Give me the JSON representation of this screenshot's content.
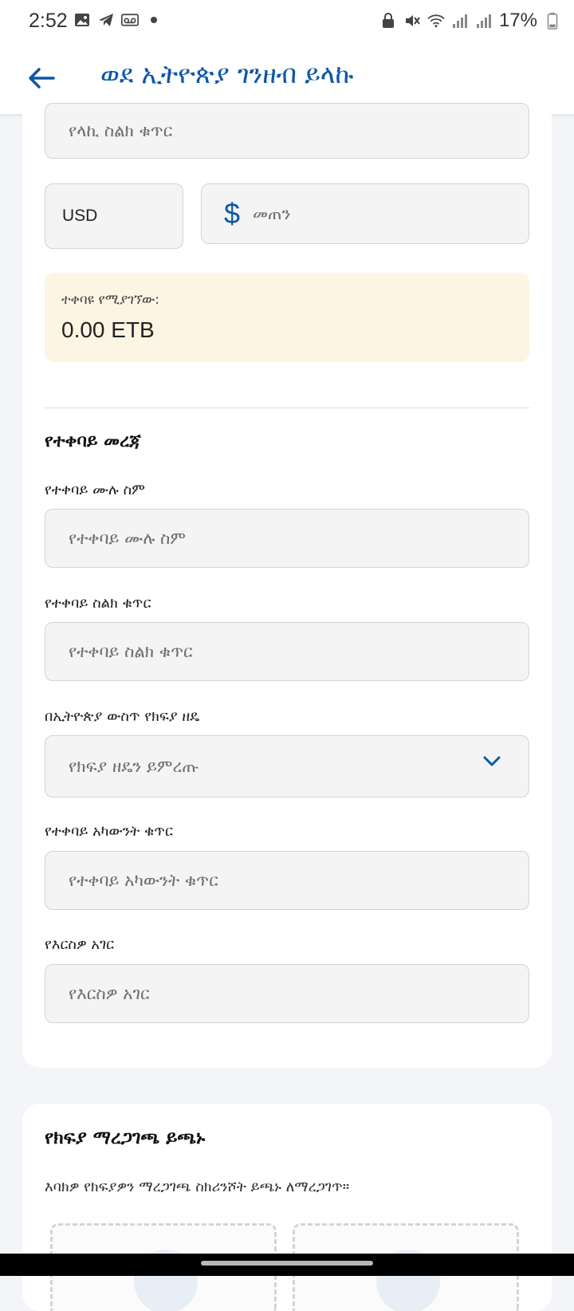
{
  "status_bar": {
    "time": "2:52",
    "battery": "17%",
    "icons_left": [
      "image-icon",
      "telegram-icon",
      "voicemail-icon",
      "dot-icon"
    ],
    "icons_right": [
      "lock-icon",
      "mute-icon",
      "wifi-icon",
      "signal-icon",
      "signal-icon",
      "battery-icon"
    ]
  },
  "app_bar": {
    "title": "ወደ ኢትዮጵያ ገንዘብ ይላኩ"
  },
  "sender": {
    "phone_placeholder": "የላኪ ስልክ ቁጥር"
  },
  "amount": {
    "currency": "USD",
    "symbol": "$",
    "placeholder": "መጠን"
  },
  "receive": {
    "label": "ተቀባዩ የሚያገኘው:",
    "value": "0.00 ETB"
  },
  "recipient": {
    "section_title": "የተቀባይ መረጃ",
    "full_name_label": "የተቀባይ ሙሉ ስም",
    "full_name_placeholder": "የተቀባይ ሙሉ ስም",
    "phone_label": "የተቀባይ ስልክ ቁጥር",
    "phone_placeholder": "የተቀባይ ስልክ ቁጥር",
    "payment_method_label": "በኢትዮጵያ ውስጥ የክፍያ ዘዴ",
    "payment_method_placeholder": "የክፍያ ዘዴን ይምረጡ",
    "account_label": "የተቀባይ አካውንት ቁጥር",
    "account_placeholder": "የተቀባይ አካውንት ቁጥር",
    "country_label": "የእርስዎ አገር",
    "country_placeholder": "የእርስዎ አገር"
  },
  "confirmation": {
    "title": "የክፍያ ማረጋገጫ ይጫኑ",
    "help": "እባክዎ የክፍያዎን ማረጋገጫ ስክሪንሾት ይጫኑ ለማረጋገጥ።"
  },
  "colors": {
    "accent": "#0d57a6",
    "highlight_bg": "#fdf5e3",
    "field_bg": "#f4f4f5",
    "page_bg": "#f3f5f8"
  }
}
